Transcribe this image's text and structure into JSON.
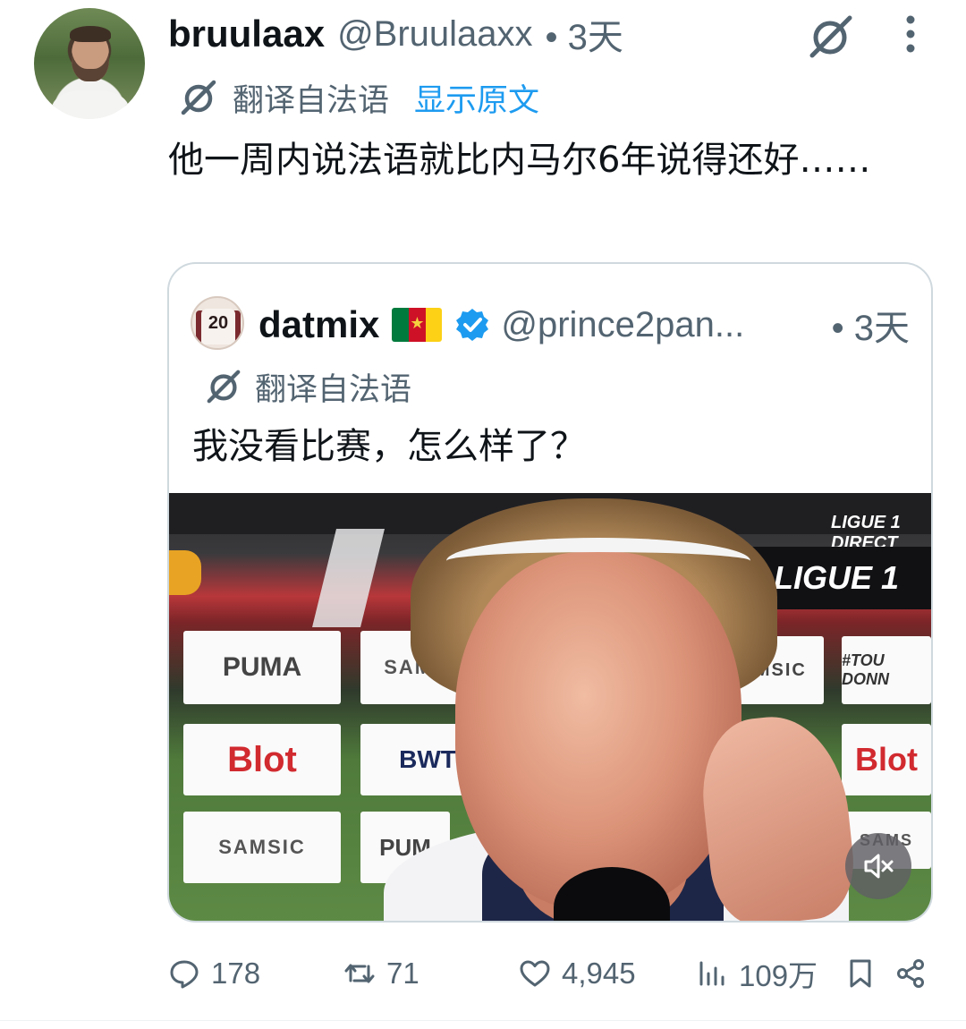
{
  "tweet": {
    "author_name": "bruulaax",
    "author_handle": "@Bruulaaxx",
    "time": "• 3天",
    "translated_from": "翻译自法语",
    "show_original": "显示原文",
    "text": "他一周内说法语就比内马尔6年说得还好……"
  },
  "quoted": {
    "author_name": "datmix",
    "avatar_number": "20",
    "author_handle": "@prince2pan...",
    "time": "• 3天",
    "translated_from": "翻译自法语",
    "text": "我没看比赛，怎么样了？",
    "flag_colors": [
      "#007a3d",
      "#ce1126",
      "#fcd116"
    ],
    "media": {
      "boards": [
        "PUMA",
        "SAMSIC",
        "SAMSIC",
        "#TOU DONN",
        "Blot",
        "BWT",
        "Blot",
        "SAMSIC",
        "PUM",
        "SAMS"
      ],
      "ligue_banner": "LIGUE 1",
      "ligue_small": "LIGUE 1 DIRECT",
      "muted": true
    }
  },
  "actions": {
    "replies": "178",
    "reposts": "71",
    "likes": "4,945",
    "views": "109万"
  },
  "colors": {
    "text_primary": "#0f1419",
    "text_secondary": "#536471",
    "link": "#1d9bf0",
    "verified": "#1d9bf0"
  },
  "icons": [
    "grok-icon",
    "more-icon",
    "translate-icon",
    "verified-icon",
    "mute-icon",
    "reply-icon",
    "repost-icon",
    "like-icon",
    "views-icon",
    "bookmark-icon",
    "share-icon"
  ]
}
